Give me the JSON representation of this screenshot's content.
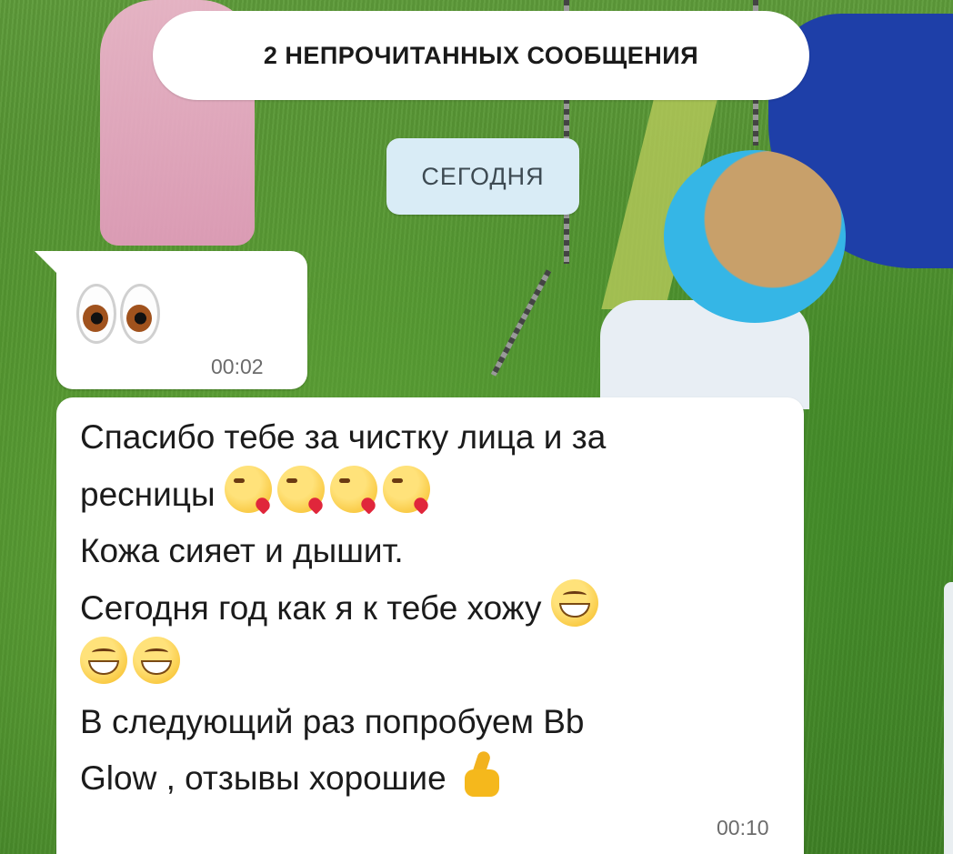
{
  "chat": {
    "unread_banner": "2 НЕПРОЧИТАННЫХ СООБЩЕНИЯ",
    "date_separator": "СЕГОДНЯ",
    "messages": [
      {
        "emoji": [
          "eyes-emoji"
        ],
        "time": "00:02"
      },
      {
        "lines": [
          "Спасибо тебе за чистку лица и за",
          "ресницы",
          "Кожа сияет и дышит.",
          "Сегодня год как я к тебе хожу",
          "В следующий раз попробуем Bb",
          "Glow , отзывы хорошие"
        ],
        "emoji": [
          "kissing-heart-emoji",
          "grinning-emoji",
          "thumbs-up-emoji"
        ],
        "time": "00:10"
      }
    ]
  },
  "colors": {
    "bubble": "#ffffff",
    "date_pill": "#d9ecf6",
    "wallpaper_grass": "#4d8e2c"
  }
}
